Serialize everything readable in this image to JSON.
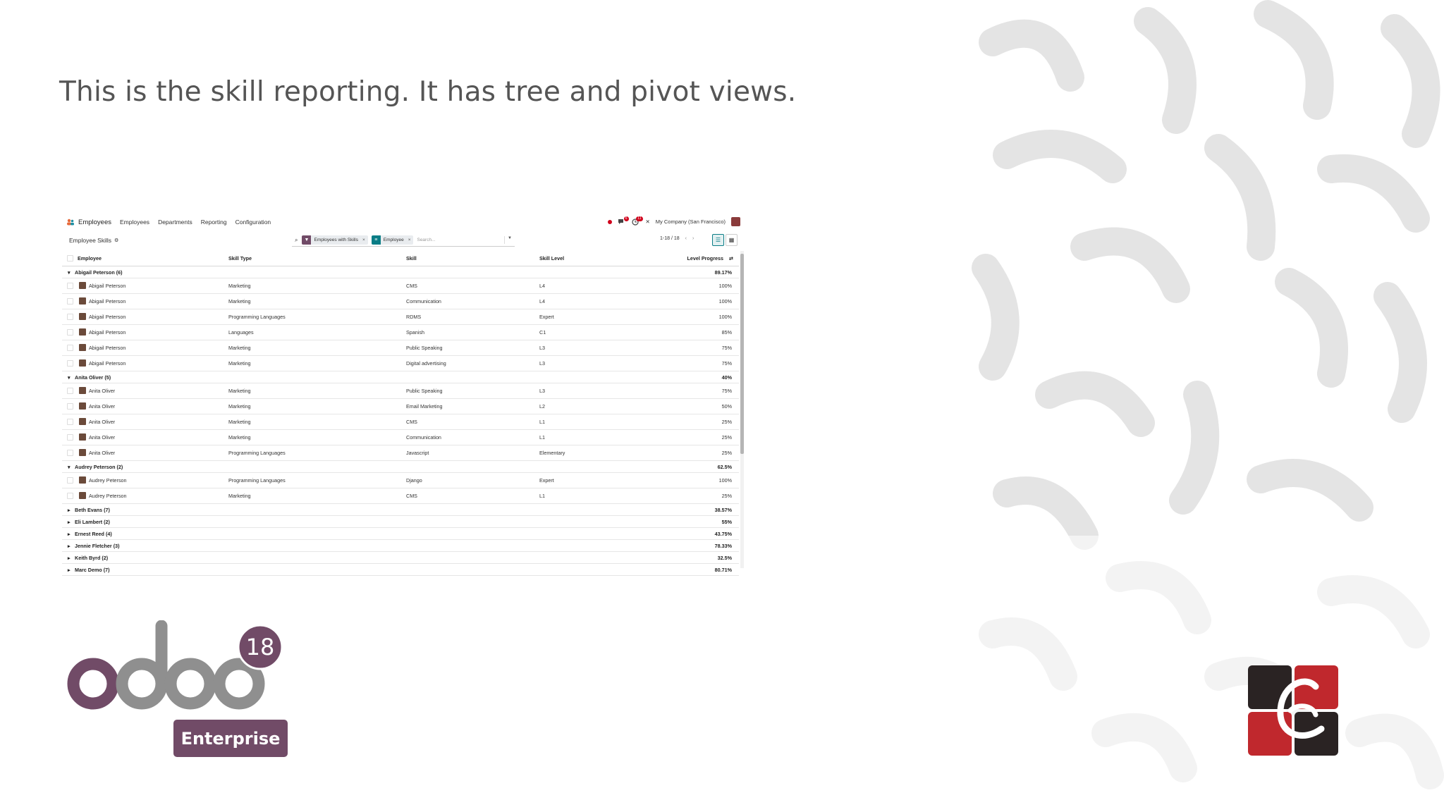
{
  "caption": "This is the skill reporting. It has tree and pivot views.",
  "app": {
    "brand": "Employees",
    "nav": [
      "Employees",
      "Departments",
      "Reporting",
      "Configuration"
    ],
    "company": "My Company (San Francisco)",
    "chat_badge": "6",
    "activity_badge": "11"
  },
  "control": {
    "title": "Employee Skills",
    "facets": [
      {
        "label": "Employees with Skills",
        "color": "#714B67"
      },
      {
        "label": "Employee",
        "color": "#0a7d86"
      }
    ],
    "search_placeholder": "Search...",
    "pager": "1-18 / 18"
  },
  "table": {
    "headers": {
      "employee": "Employee",
      "skill_type": "Skill Type",
      "skill": "Skill",
      "skill_level": "Skill Level",
      "level_progress": "Level Progress"
    },
    "groups": [
      {
        "name": "Abigail Peterson (6)",
        "progress": "89.17%",
        "expanded": true,
        "rows": [
          {
            "employee": "Abigail Peterson",
            "type": "Marketing",
            "skill": "CMS",
            "level": "L4",
            "progress": "100%"
          },
          {
            "employee": "Abigail Peterson",
            "type": "Marketing",
            "skill": "Communication",
            "level": "L4",
            "progress": "100%"
          },
          {
            "employee": "Abigail Peterson",
            "type": "Programming Languages",
            "skill": "RDMS",
            "level": "Expert",
            "progress": "100%"
          },
          {
            "employee": "Abigail Peterson",
            "type": "Languages",
            "skill": "Spanish",
            "level": "C1",
            "progress": "85%"
          },
          {
            "employee": "Abigail Peterson",
            "type": "Marketing",
            "skill": "Public Speaking",
            "level": "L3",
            "progress": "75%"
          },
          {
            "employee": "Abigail Peterson",
            "type": "Marketing",
            "skill": "Digital advertising",
            "level": "L3",
            "progress": "75%"
          }
        ]
      },
      {
        "name": "Anita Oliver (5)",
        "progress": "40%",
        "expanded": true,
        "rows": [
          {
            "employee": "Anita Oliver",
            "type": "Marketing",
            "skill": "Public Speaking",
            "level": "L3",
            "progress": "75%"
          },
          {
            "employee": "Anita Oliver",
            "type": "Marketing",
            "skill": "Email Marketing",
            "level": "L2",
            "progress": "50%"
          },
          {
            "employee": "Anita Oliver",
            "type": "Marketing",
            "skill": "CMS",
            "level": "L1",
            "progress": "25%"
          },
          {
            "employee": "Anita Oliver",
            "type": "Marketing",
            "skill": "Communication",
            "level": "L1",
            "progress": "25%"
          },
          {
            "employee": "Anita Oliver",
            "type": "Programming Languages",
            "skill": "Javascript",
            "level": "Elementary",
            "progress": "25%"
          }
        ]
      },
      {
        "name": "Audrey Peterson (2)",
        "progress": "62.5%",
        "expanded": true,
        "rows": [
          {
            "employee": "Audrey Peterson",
            "type": "Programming Languages",
            "skill": "Django",
            "level": "Expert",
            "progress": "100%"
          },
          {
            "employee": "Audrey Peterson",
            "type": "Marketing",
            "skill": "CMS",
            "level": "L1",
            "progress": "25%"
          }
        ]
      },
      {
        "name": "Beth Evans (7)",
        "progress": "38.57%",
        "expanded": false,
        "rows": []
      },
      {
        "name": "Eli Lambert (2)",
        "progress": "55%",
        "expanded": false,
        "rows": []
      },
      {
        "name": "Ernest Reed (4)",
        "progress": "43.75%",
        "expanded": false,
        "rows": []
      },
      {
        "name": "Jennie Fletcher (3)",
        "progress": "78.33%",
        "expanded": false,
        "rows": []
      },
      {
        "name": "Keith Byrd (2)",
        "progress": "32.5%",
        "expanded": false,
        "rows": []
      },
      {
        "name": "Marc Demo (7)",
        "progress": "80.71%",
        "expanded": false,
        "rows": []
      }
    ]
  },
  "odoo": {
    "wordmark": "odoo",
    "version": "18",
    "edition": "Enterprise"
  },
  "colors": {
    "brand": "#714B67",
    "accent_teal": "#0a7d86",
    "logo_red": "#c0282d",
    "logo_dark": "#2a2323"
  }
}
